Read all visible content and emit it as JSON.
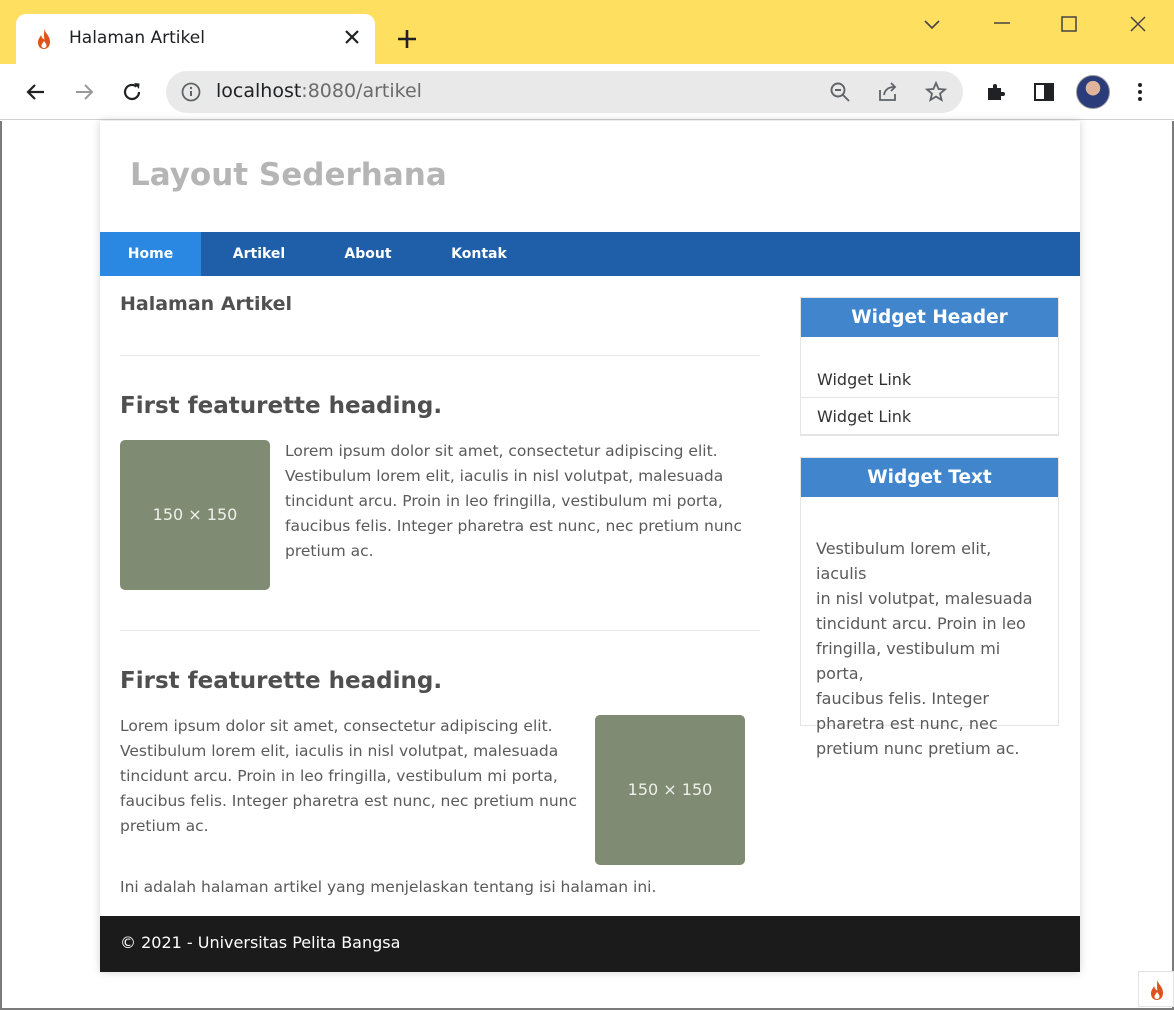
{
  "browser": {
    "tab": {
      "title": "Halaman Artikel"
    },
    "address_bar": {
      "host": "localhost",
      "rest": ":8080/artikel"
    }
  },
  "site": {
    "title": "Layout Sederhana",
    "nav": [
      {
        "label": "Home",
        "active": true
      },
      {
        "label": "Artikel",
        "active": false
      },
      {
        "label": "About",
        "active": false
      },
      {
        "label": "Kontak",
        "active": false
      }
    ],
    "page_heading": "Halaman Artikel",
    "featurettes": [
      {
        "heading": "First featurette heading.",
        "image_label": "150 × 150",
        "lines": [
          "Lorem ipsum dolor sit amet, consectetur adipiscing elit.",
          "Vestibulum lorem elit, iaculis in nisl volutpat, malesuada",
          "tincidunt arcu. Proin in leo fringilla, vestibulum mi porta,",
          "faucibus felis. Integer pharetra est nunc, nec pretium nunc",
          "pretium ac."
        ]
      },
      {
        "heading": "First featurette heading.",
        "image_label": "150 × 150",
        "lines": [
          "Lorem ipsum dolor sit amet, consectetur adipiscing elit.",
          "Vestibulum lorem elit, iaculis in nisl volutpat, malesuada",
          "tincidunt arcu. Proin in leo fringilla, vestibulum mi porta,",
          "faucibus felis. Integer pharetra est nunc, nec pretium nunc",
          "pretium ac."
        ]
      }
    ],
    "page_text": "Ini adalah halaman artikel yang menjelaskan tentang isi halaman ini.",
    "sidebar": {
      "widget_header": {
        "title": "Widget Header",
        "links": [
          "Widget Link",
          "Widget Link"
        ]
      },
      "widget_text": {
        "title": "Widget Text",
        "lines": [
          "Vestibulum lorem elit, iaculis",
          "in nisl volutpat, malesuada",
          "tincidunt arcu. Proin in leo",
          "fringilla, vestibulum mi porta,",
          "faucibus felis. Integer",
          "pharetra est nunc, nec",
          "pretium nunc pretium ac."
        ]
      }
    },
    "footer": "© 2021 - Universitas Pelita Bangsa"
  },
  "colors": {
    "chrome_titlebar": "#fedf60",
    "nav_bar": "#1f5faa",
    "nav_active": "#2a88e3",
    "widget_header": "#4186cc",
    "placeholder_image": "#7f8b72",
    "footer": "#1b1b1b"
  }
}
